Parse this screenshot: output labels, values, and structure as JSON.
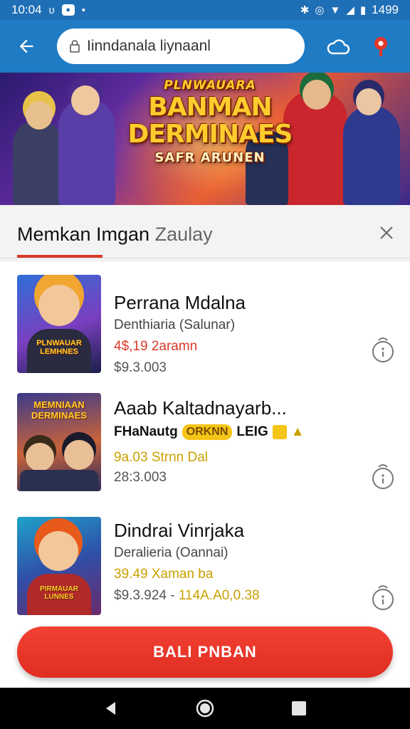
{
  "status_bar": {
    "time": "10:04",
    "right_text": "1499"
  },
  "app_bar": {
    "search_text": "Iinndanala liynaanl",
    "icons": [
      "back-arrow-icon",
      "lock-icon",
      "cloud-icon",
      "location-pin-icon"
    ]
  },
  "banner": {
    "line1": "PLNWAUARA",
    "line2": "BANMAN",
    "line3": "DERMINAES",
    "line4": "SAFR ARUNEN"
  },
  "filter": {
    "title_main": "Memkan Imgan",
    "title_dim": "Zaulay"
  },
  "items": [
    {
      "title": "Perrana Mdalna",
      "subtitle": "Denthiaria (Salunar)",
      "price": "4$,19 2aramn",
      "price_color": "#d93a2a",
      "meta": "$9.3.003",
      "thumb_text": "PLNWAUAR LEMHNES"
    },
    {
      "title": "Aaab Kaltadnayarb...",
      "subtitle": "FHaNautg",
      "subtitle_tag": "ORKNN",
      "subtitle_suffix": "LEIG",
      "price": "9a.03 Strnn Dal",
      "price_color": "#c9a100",
      "meta": "28:3.003",
      "thumb_text": "MEMNIAAN DERMINAES"
    },
    {
      "title": "Dindrai Vinrjaka",
      "subtitle": "Deralieria (Oannai)",
      "price": "39.49 Xaman ba",
      "price_color": "#c9a100",
      "meta": "$9.3.924 - ",
      "meta_accent": "114A.A0,0.38",
      "thumb_text": "PIRMAUAR LUNNES"
    }
  ],
  "cta": {
    "label": "BALI PNBAN"
  }
}
